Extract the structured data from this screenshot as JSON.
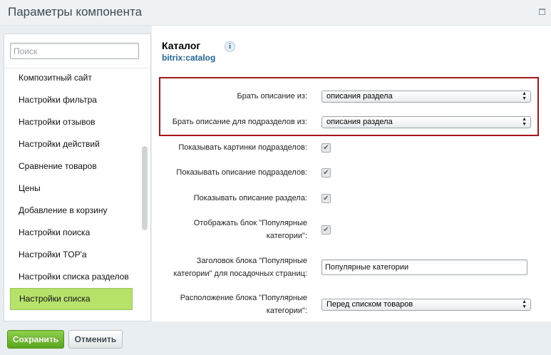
{
  "window": {
    "title": "Параметры компонента"
  },
  "sidebar": {
    "search_placeholder": "Поиск",
    "items": [
      {
        "label": "Композитный сайт"
      },
      {
        "label": "Настройки фильтра"
      },
      {
        "label": "Настройки отзывов"
      },
      {
        "label": "Настройки действий"
      },
      {
        "label": "Сравнение товаров"
      },
      {
        "label": "Цены"
      },
      {
        "label": "Добавление в корзину"
      },
      {
        "label": "Настройки поиска"
      },
      {
        "label": "Настройки TOP'а"
      },
      {
        "label": "Настройки списка разделов"
      },
      {
        "label": "Настройки списка",
        "active": true
      }
    ]
  },
  "main": {
    "title": "Каталог",
    "subtitle": "bitrix:catalog",
    "fields": {
      "desc_source": {
        "label": "Брать описание из:",
        "value": "описания раздела"
      },
      "subsection_desc_source": {
        "label": "Брать описание для подразделов из:",
        "value": "описания раздела"
      },
      "show_subsection_pictures": {
        "label": "Показывать картинки подразделов:",
        "checked": true
      },
      "show_subsection_desc": {
        "label": "Показывать описание подразделов:",
        "checked": true
      },
      "show_section_desc": {
        "label": "Показывать описание раздела:",
        "checked": true
      },
      "show_popular_block": {
        "label_line1": "Отображать блок \"Популярные",
        "label_line2": "категории\":",
        "checked": true
      },
      "popular_block_title": {
        "label_line1": "Заголовок блока \"Популярные",
        "label_line2": "категории\" для посадочных страниц:",
        "value": "Популярные категории"
      },
      "popular_block_position": {
        "label_line1": "Расположение блока \"Популярные",
        "label_line2": "категории\":",
        "value": "Перед списком товаров"
      }
    }
  },
  "footer": {
    "save_label": "Сохранить",
    "cancel_label": "Отменить"
  },
  "colors": {
    "accent_green": "#5aa51e",
    "active_item": "#b7e26a",
    "highlight_border": "#a4161a",
    "link_blue": "#23659b"
  }
}
